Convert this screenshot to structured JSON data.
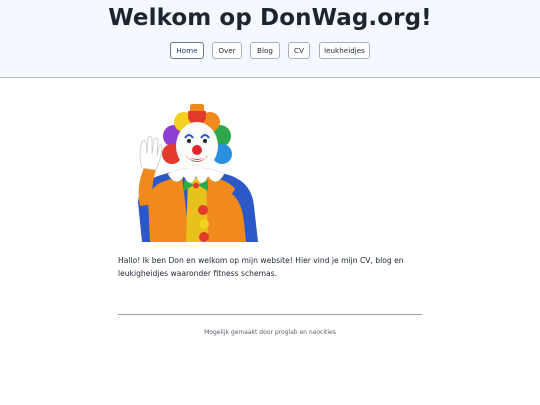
{
  "header": {
    "title": "Welkom op DonWag.org!",
    "nav": [
      {
        "label": "Home",
        "active": true
      },
      {
        "label": "Over",
        "active": false
      },
      {
        "label": "Blog",
        "active": false
      },
      {
        "label": "CV",
        "active": false
      },
      {
        "label": "leukheidjes",
        "active": false
      }
    ]
  },
  "main": {
    "hero_image": "waving-clown-illustration",
    "intro": "Hallo! Ik ben Don en welkom op mijn website! Hier vind je mijn CV, blog en leukigheidjes waaronder fitness schemas."
  },
  "footer": {
    "note": "Mogelijk gemaakt door proglab en neocities"
  },
  "colors": {
    "header_bg": "#f5f8fe",
    "accent": "#1c3f7c"
  }
}
